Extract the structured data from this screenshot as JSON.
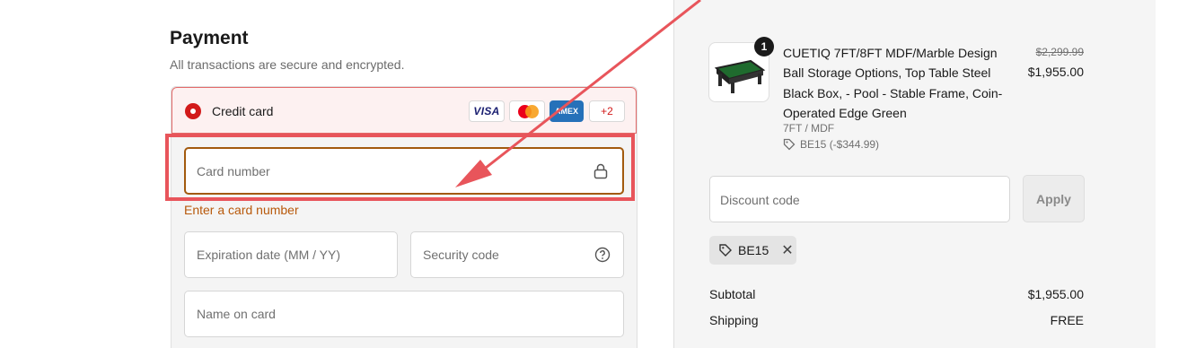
{
  "payment": {
    "title": "Payment",
    "subtitle": "All transactions are secure and encrypted.",
    "method_label": "Credit card",
    "brands": {
      "visa": "VISA",
      "amex": "AMEX",
      "more": "+2"
    },
    "card_number_placeholder": "Card number",
    "card_number_error": "Enter a card number",
    "expiration_placeholder": "Expiration date (MM / YY)",
    "security_placeholder": "Security code",
    "name_placeholder": "Name on card"
  },
  "order": {
    "quantity": "1",
    "product_name": "CUETIQ 7FT/8FT MDF/Marble Design Ball Storage Options, Top Table Steel Black Box, - Pool - Stable Frame, Coin-Operated Edge Green",
    "variant": "7FT / MDF",
    "line_discount": "BE15 (-$344.99)",
    "original_price": "$2,299.99",
    "price": "$1,955.00",
    "discount_placeholder": "Discount code",
    "apply_label": "Apply",
    "applied_code": "BE15",
    "summary": [
      {
        "label": "Subtotal",
        "value": "$1,955.00"
      },
      {
        "label": "Shipping",
        "value": "FREE"
      }
    ]
  },
  "colors": {
    "accent": "#d21a1a",
    "error": "#b8590b",
    "annotation": "#e8555b"
  }
}
